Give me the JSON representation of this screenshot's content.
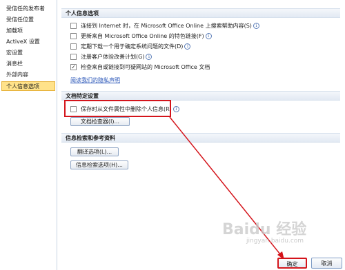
{
  "nav": {
    "items": [
      {
        "label": "受信任的发布者"
      },
      {
        "label": "受信任位置"
      },
      {
        "label": "加载项"
      },
      {
        "label": "ActiveX 设置"
      },
      {
        "label": "宏设置"
      },
      {
        "label": "消息栏"
      },
      {
        "label": "外部内容"
      },
      {
        "label": "个人信息选项"
      }
    ]
  },
  "personal": {
    "heading": "个人信息选项",
    "options": [
      {
        "label": "连接到 Internet 时，在 Microsoft Office Online 上搜索帮助内容(S)",
        "checked": false
      },
      {
        "label": "更新来自 Microsoft Office Online 的特色链接(F)",
        "checked": false
      },
      {
        "label": "定期下载一个用于确定系统问题的文件(D)",
        "checked": false
      },
      {
        "label": "注册客户体验改善计划(G)",
        "checked": false
      },
      {
        "label": "检查来自或链接到可疑网站的 Microsoft Office 文档",
        "checked": true
      }
    ],
    "privacy_link": "阅读我们的隐私声明"
  },
  "doc": {
    "heading": "文档特定设置",
    "remove_info_label": "保存时从文件属性中删除个人信息(R)",
    "remove_info_checked": false,
    "inspector_button": "文档检查器(I)..."
  },
  "research": {
    "heading": "信息检索和参考资料",
    "translate_button": "翻译选项(L)...",
    "research_button": "信息检索选项(H)..."
  },
  "footer": {
    "ok": "确定",
    "cancel": "取消"
  },
  "watermark": {
    "logo": "Baidu 经验",
    "url": "jingyan.baidu.com"
  },
  "colors": {
    "annotation": "#d4141b",
    "selected_nav": "#ffe28a"
  }
}
